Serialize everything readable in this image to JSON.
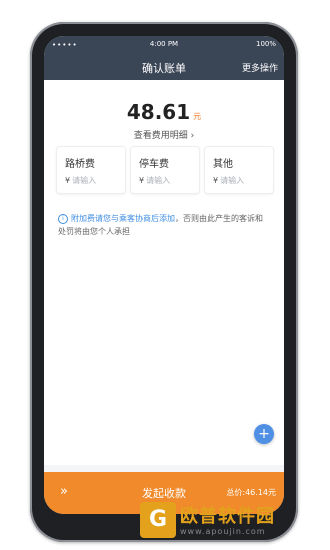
{
  "status": {
    "dots": "•••••",
    "time": "4:00 PM",
    "battery": "100%"
  },
  "header": {
    "title": "确认账单",
    "more": "更多操作"
  },
  "amount": {
    "value": "48.61",
    "unit": "元",
    "detail": "查看费用明细 ›"
  },
  "cards": [
    {
      "label": "路桥费",
      "currency": "¥",
      "placeholder": "请输入"
    },
    {
      "label": "停车费",
      "currency": "¥",
      "placeholder": "请输入"
    },
    {
      "label": "其他",
      "currency": "¥",
      "placeholder": "请输入"
    }
  ],
  "notice": {
    "icon": "i",
    "link": "附加费请您与乘客协商后添加",
    "rest": "，否则由此产生的客诉和处罚将由您个人承担"
  },
  "fab": {
    "icon": "+"
  },
  "bottom": {
    "chevron": "»",
    "start": "发起收款",
    "total": "总价:46.14元"
  },
  "watermark": {
    "logo": "G",
    "name": "欧普软件园",
    "url": "www.apoujin.com"
  }
}
